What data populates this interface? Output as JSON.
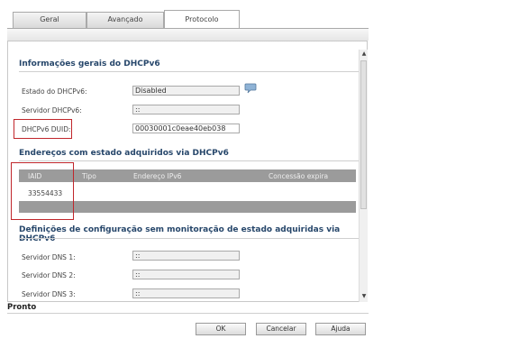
{
  "tabs": [
    {
      "label": "Geral"
    },
    {
      "label": "Avançado"
    },
    {
      "label": "Protocolo"
    }
  ],
  "section_general": {
    "title": "Informações gerais do DHCPv6",
    "state_label": "Estado do DHCPv6:",
    "state_value": "Disabled",
    "server_label": "Servidor DHCPv6:",
    "server_value": "::",
    "duid_label": "DHCPv6 DUID:",
    "duid_value": "00030001c0eae40eb038"
  },
  "section_addresses": {
    "title": "Endereços com estado adquiridos via DHCPv6",
    "columns": [
      "IAID",
      "Tipo",
      "Endereço IPv6",
      "Concessão expira"
    ],
    "rows": [
      {
        "iaid": "33554433"
      }
    ]
  },
  "section_config": {
    "title": "Definições de configuração sem monitoração de estado adquiridas via DHCPv6",
    "dns1_label": "Servidor DNS 1:",
    "dns1_value": "::",
    "dns2_label": "Servidor DNS 2:",
    "dns2_value": "::",
    "dns3_label": "Servidor DNS 3:",
    "dns3_value": "::"
  },
  "status_text": "Pronto",
  "buttons": {
    "ok": "OK",
    "cancel": "Cancelar",
    "help": "Ajuda"
  },
  "icons": {
    "comment": "speech-bubble-icon"
  },
  "colors": {
    "section_title": "#27476b",
    "highlight_border": "#c0262b",
    "table_header_bg": "#9b9b9b"
  }
}
